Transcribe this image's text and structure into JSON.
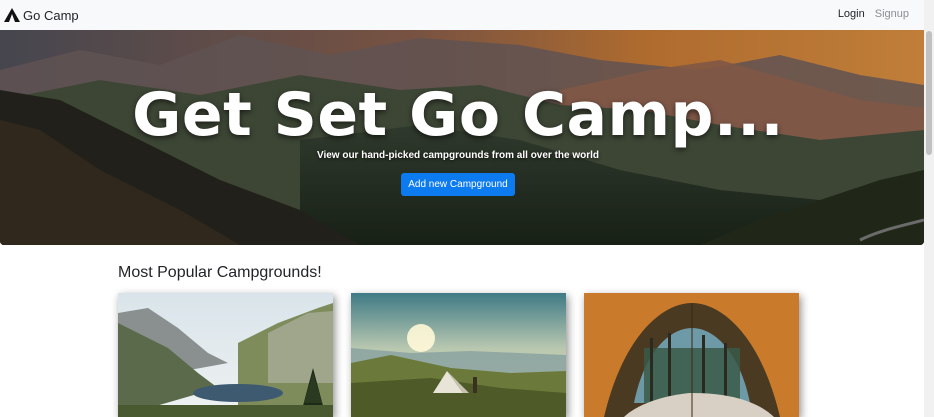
{
  "navbar": {
    "brand": "Go Camp",
    "brand_icon": "tent-icon",
    "login": "Login",
    "signup": "Signup"
  },
  "hero": {
    "title": "Get Set Go Camp...",
    "subtitle": "View our hand-picked campgrounds from all over the world",
    "button_label": "Add new Campground",
    "button_color": "#0d7bf0"
  },
  "main": {
    "section_title": "Most Popular Campgrounds!",
    "cards": [
      {
        "image": "mountain-lake-image"
      },
      {
        "image": "sunset-tent-image"
      },
      {
        "image": "tent-forest-view-image"
      }
    ]
  }
}
